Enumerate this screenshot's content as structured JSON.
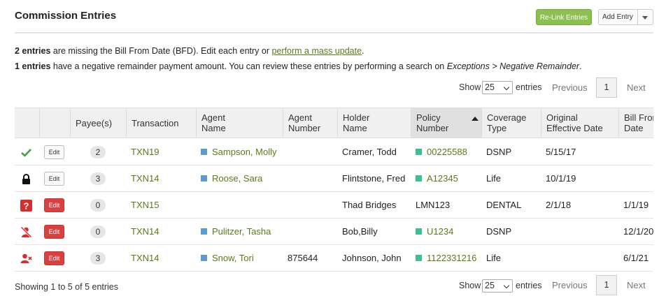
{
  "header": {
    "title": "Commission Entries",
    "relink_label": "Re-Link Entries",
    "add_entry_label": "Add Entry"
  },
  "notices": {
    "n1_bold": "2 entries",
    "n1_text": " are missing the Bill From Date (BFD). Edit each entry or ",
    "n1_link": "perform a mass update",
    "n1_end": ".",
    "n2_bold": "1 entries",
    "n2_text": " have a negative remainder payment amount. You can review these entries by performing a search on ",
    "n2_italic": "Exceptions > Negative Remainder",
    "n2_end": "."
  },
  "pager": {
    "show_label": "Show",
    "page_size": "25",
    "entries_label": "entries",
    "previous": "Previous",
    "page": "1",
    "next": "Next"
  },
  "columns": [
    "Payee(s)",
    "Transaction",
    "Agent Name",
    "Agent Number",
    "Holder Name",
    "Policy Number",
    "Coverage Type",
    "Original Effective Date",
    "Bill From Date"
  ],
  "columns_display": {
    "payee": "Payee(s)",
    "transaction": "Transaction",
    "agent_name": "Agent\nName",
    "agent_number": "Agent\nNumber",
    "holder_name": "Holder\nName",
    "policy_number": "Policy\nNumber",
    "coverage_type": "Coverage\nType",
    "orig_eff_date": "Original\nEffective Date",
    "bill_from_date": "Bill From\nDate"
  },
  "rows": [
    {
      "status_icon": "check-icon",
      "edit": "Edit",
      "edit_style": "plain",
      "payees": "2",
      "transaction": "TXN19",
      "agent_name": "Sampson, Molly",
      "agent_number": "",
      "holder_name": "Cramer, Todd",
      "policy_number": "00225588",
      "policy_marker": true,
      "coverage_type": "DSNP",
      "orig_eff_date": "5/15/17",
      "bill_from_date": ""
    },
    {
      "status_icon": "lock-icon",
      "edit": "Edit",
      "edit_style": "plain",
      "payees": "3",
      "transaction": "TXN14",
      "agent_name": "Roose, Sara",
      "agent_number": "",
      "holder_name": "Flintstone, Fred",
      "policy_number": "A12345",
      "policy_marker": true,
      "coverage_type": "Life",
      "orig_eff_date": "10/1/19",
      "bill_from_date": ""
    },
    {
      "status_icon": "question-icon",
      "edit": "Edit",
      "edit_style": "red",
      "payees": "0",
      "transaction": "TXN15",
      "agent_name": "",
      "agent_number": "",
      "holder_name": "Thad Bridges",
      "policy_number": "LMN123",
      "policy_marker": false,
      "coverage_type": "DENTAL",
      "orig_eff_date": "2/1/18",
      "bill_from_date": "1/1/19"
    },
    {
      "status_icon": "user-slash-icon",
      "edit": "Edit",
      "edit_style": "red",
      "payees": "0",
      "transaction": "TXN14",
      "agent_name": "Pulitzer, Tasha",
      "agent_number": "",
      "holder_name": "Bob,Billy",
      "policy_number": "U1234",
      "policy_marker": true,
      "coverage_type": "DSNP",
      "orig_eff_date": "",
      "bill_from_date": "12/1/20"
    },
    {
      "status_icon": "user-times-icon",
      "edit": "Edit",
      "edit_style": "red",
      "payees": "3",
      "transaction": "TXN14",
      "agent_name": "Snow, Tori",
      "agent_number": "875644",
      "holder_name": "Johnson, John",
      "policy_number": "1122331216",
      "policy_marker": true,
      "coverage_type": "Life",
      "orig_eff_date": "",
      "bill_from_date": "6/1/21"
    }
  ],
  "footer": {
    "showing": "Showing 1 to 5 of 5 entries"
  },
  "colors": {
    "accent_green": "#8cc152",
    "link_green": "#5a7a1a",
    "danger_red": "#d94040",
    "agent_blue": "#5b9bd5",
    "policy_teal": "#3fbf8f"
  }
}
